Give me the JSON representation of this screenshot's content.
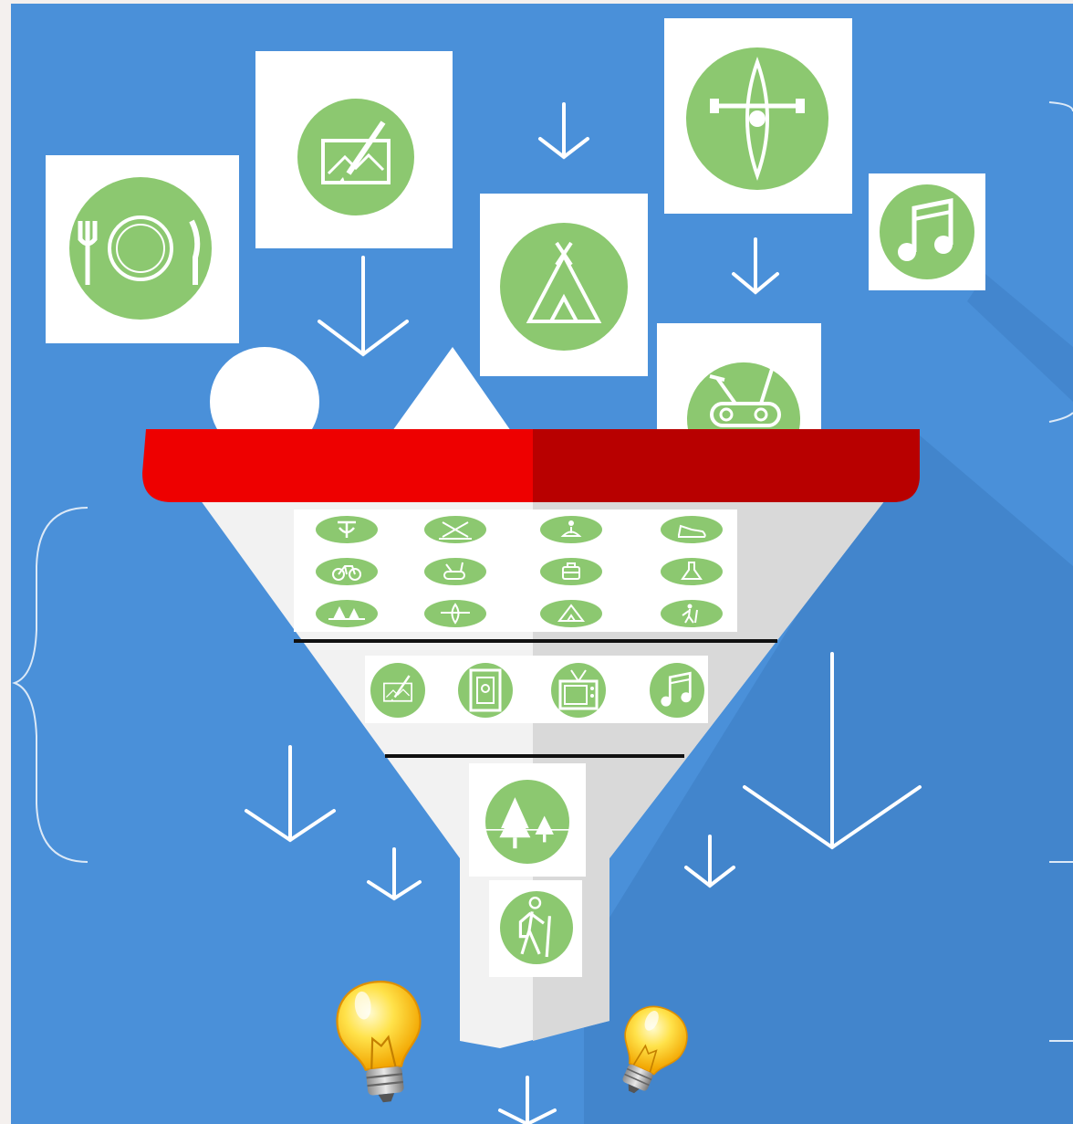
{
  "diagram": {
    "background_color": "#4a90d9",
    "page_color": "#f4f0ee",
    "funnel_rim_color": "#ee0000",
    "funnel_body_color": "#f2f2f2",
    "icon_circle_color": "#8cc870",
    "stroke_color": "#ffffff",
    "falling_activities": [
      {
        "name": "dining",
        "icon": "plate-fork-knife-icon"
      },
      {
        "name": "painting",
        "icon": "easel-brush-icon"
      },
      {
        "name": "camping",
        "icon": "tent-icon"
      },
      {
        "name": "kayaking",
        "icon": "kayak-icon"
      },
      {
        "name": "music",
        "icon": "music-note-icon"
      },
      {
        "name": "cycling-exercise",
        "icon": "exercise-bike-icon"
      }
    ],
    "funnel_top_tier": [
      "disc-golf-icon",
      "skiing-icon",
      "yoga-icon",
      "shoe-icon",
      "bicycle-icon",
      "exercise-bike-icon",
      "luggage-icon",
      "science-flask-icon",
      "forest-icon",
      "kayak-icon",
      "tent-icon",
      "hiking-icon"
    ],
    "funnel_middle_tier": [
      "painting-icon",
      "photo-frame-icon",
      "tv-icon",
      "music-note-icon"
    ],
    "funnel_bottom_tier": [
      "forest-icon",
      "hiker-icon"
    ],
    "outputs": [
      "lightbulb-icon",
      "lightbulb-icon"
    ]
  }
}
